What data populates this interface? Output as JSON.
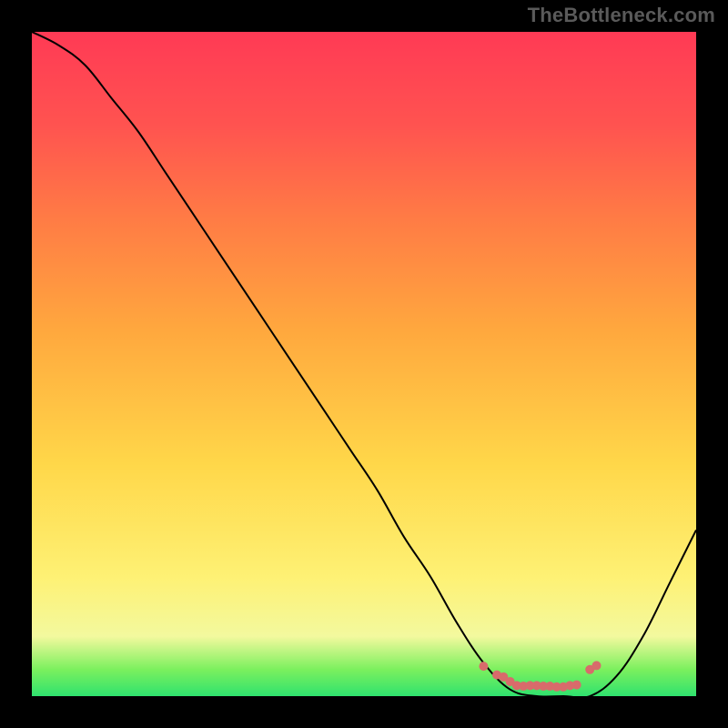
{
  "watermark": "TheBottleneck.com",
  "gradient_colors": {
    "bottom": "#2fe26e",
    "mid_low": "#f3f99e",
    "mid": "#fef174",
    "mid_high": "#ffa83e",
    "upper": "#ff5350",
    "top": "#ff3a55"
  },
  "chart_data": {
    "type": "line",
    "title": "",
    "xlabel": "",
    "ylabel": "",
    "xlim": [
      0,
      100
    ],
    "ylim": [
      0,
      100
    ],
    "x": [
      0,
      4,
      8,
      12,
      16,
      20,
      24,
      28,
      32,
      36,
      40,
      44,
      48,
      52,
      56,
      60,
      64,
      68,
      72,
      76,
      80,
      84,
      88,
      92,
      96,
      100
    ],
    "values": [
      100,
      98,
      95,
      90,
      85,
      79,
      73,
      67,
      61,
      55,
      49,
      43,
      37,
      31,
      24,
      18,
      11,
      5,
      1,
      0,
      0,
      0,
      3,
      9,
      17,
      25
    ],
    "markers": {
      "x": [
        68,
        70,
        71,
        72,
        73,
        74,
        75,
        76,
        77,
        78,
        79,
        80,
        81,
        82,
        84,
        85
      ],
      "y": [
        4.5,
        3.2,
        2.9,
        2.2,
        1.6,
        1.5,
        1.6,
        1.6,
        1.5,
        1.5,
        1.4,
        1.4,
        1.6,
        1.7,
        4.0,
        4.6
      ],
      "color": "#d86b6b",
      "radius": 5
    },
    "curve_color": "#000000",
    "curve_width": 2
  }
}
